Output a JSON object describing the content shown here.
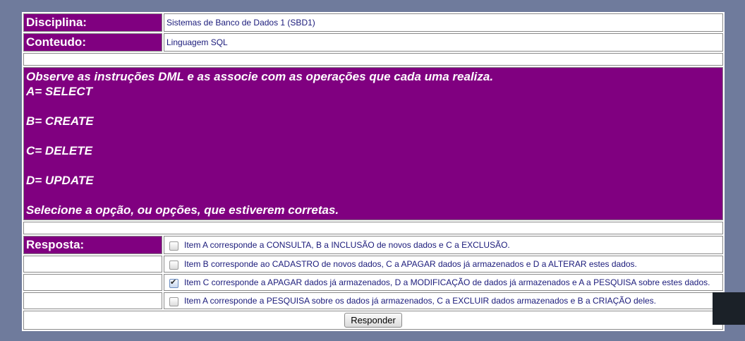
{
  "discipline": {
    "label": "Disciplina:",
    "value": "Sistemas de Banco de Dados 1 (SBD1)"
  },
  "content": {
    "label": "Conteudo:",
    "value": "Linguagem SQL"
  },
  "question": {
    "lines": [
      "Observe as instruções DML e as associe com as operações que cada uma realiza.",
      "A= SELECT",
      "",
      "B= CREATE",
      "",
      "C= DELETE",
      "",
      "D= UPDATE",
      "",
      "Selecione a opção, ou opções, que estiverem corretas."
    ]
  },
  "answer": {
    "label": "Resposta:",
    "options": [
      {
        "text": "Item A corresponde a CONSULTA, B a INCLUSÃO de novos dados e C a EXCLUSÃO.",
        "checked": false
      },
      {
        "text": "Item B corresponde ao CADASTRO de novos dados, C a APAGAR dados já armazenados e D a ALTERAR estes dados.",
        "checked": false
      },
      {
        "text": "Item C corresponde a APAGAR dados já armazenados, D a MODIFICAÇÃO de dados já armazenados e A a PESQUISA sobre estes dados.",
        "checked": true
      },
      {
        "text": "Item A corresponde a PESQUISA sobre os dados já armazenados, C a EXCLUIR dados armazenados e B a CRIAÇÃO deles.",
        "checked": false
      }
    ]
  },
  "submit_label": "Responder"
}
